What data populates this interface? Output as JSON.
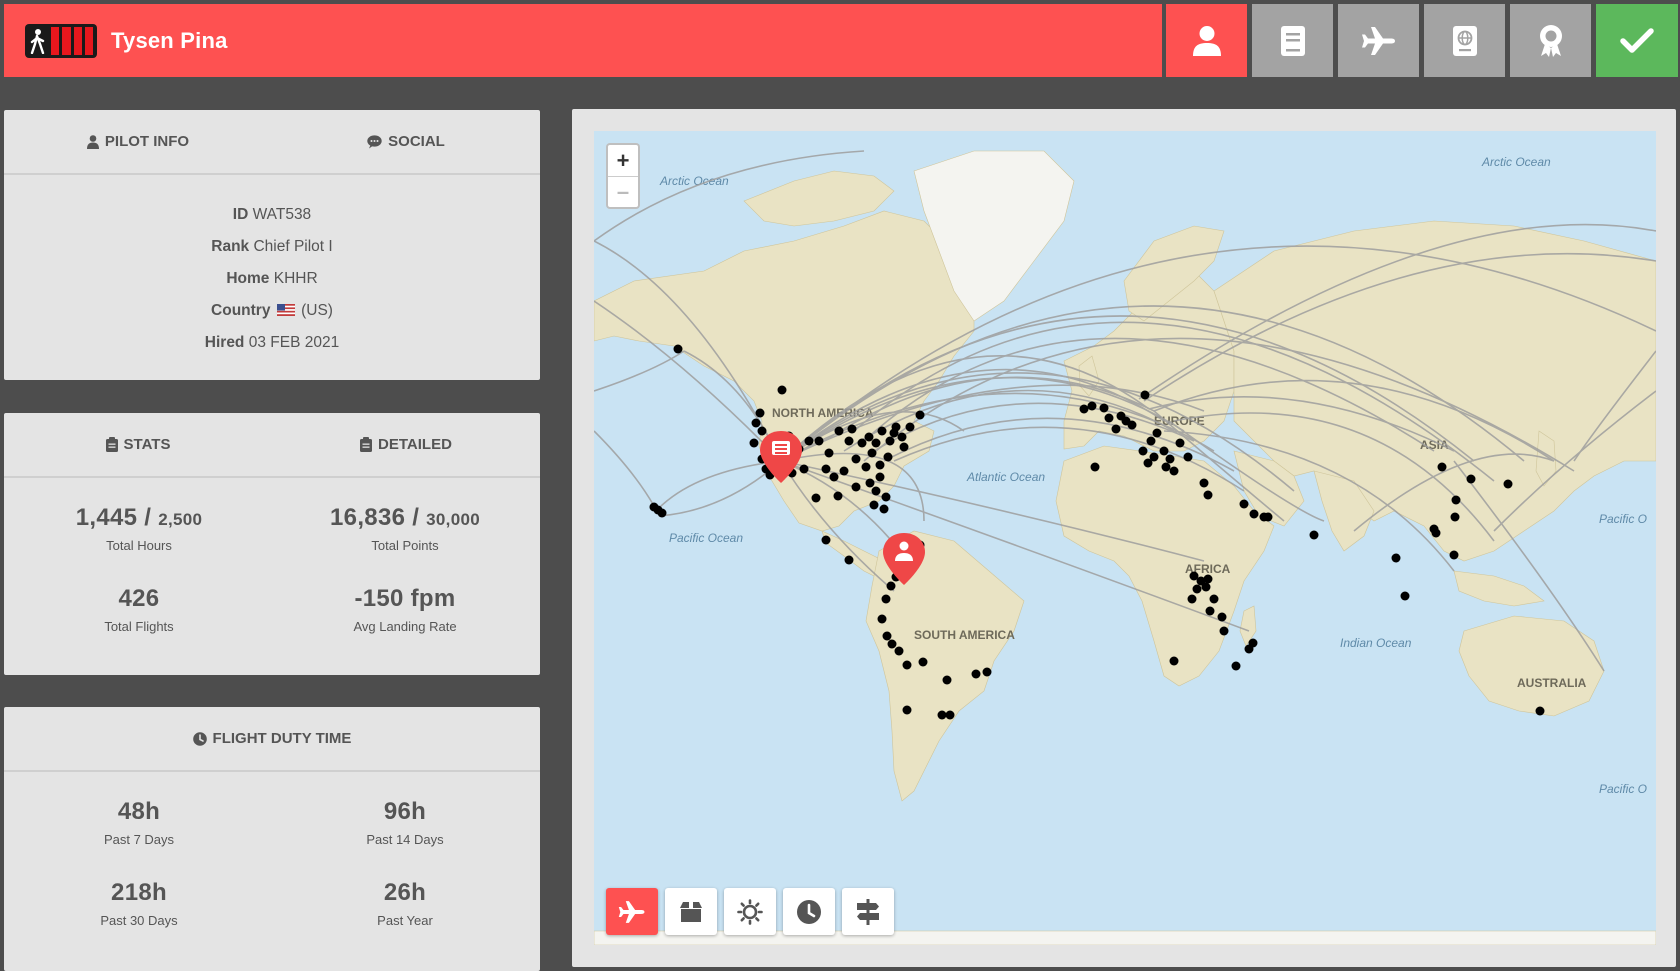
{
  "header": {
    "pilot_name": "Tysen Pina"
  },
  "nav": [
    {
      "name": "profile",
      "icon": "user-icon",
      "active": true
    },
    {
      "name": "logbook",
      "icon": "book-icon",
      "active": false
    },
    {
      "name": "flights",
      "icon": "plane-icon",
      "active": false
    },
    {
      "name": "passport",
      "icon": "passport-icon",
      "active": false
    },
    {
      "name": "awards",
      "icon": "award-icon",
      "active": false
    },
    {
      "name": "confirm",
      "icon": "check-icon",
      "active": false
    }
  ],
  "pilot_panel": {
    "tab_info": "PILOT INFO",
    "tab_social": "SOCIAL",
    "id_label": "ID",
    "id_value": "WAT538",
    "rank_label": "Rank",
    "rank_value": "Chief Pilot I",
    "home_label": "Home",
    "home_value": "KHHR",
    "country_label": "Country",
    "country_value": "(US)",
    "hired_label": "Hired",
    "hired_value": "03 FEB 2021"
  },
  "stats_panel": {
    "tab_stats": "STATS",
    "tab_detailed": "DETAILED",
    "hours_value": "1,445 /",
    "hours_goal": "2,500",
    "hours_label": "Total Hours",
    "points_value": "16,836 /",
    "points_goal": "30,000",
    "points_label": "Total Points",
    "flights_value": "426",
    "flights_label": "Total Flights",
    "landing_value": "-150 fpm",
    "landing_label": "Avg Landing Rate"
  },
  "duty_panel": {
    "title": "FLIGHT DUTY TIME",
    "d7_value": "48h",
    "d7_label": "Past 7 Days",
    "d14_value": "96h",
    "d14_label": "Past 14 Days",
    "d30_value": "218h",
    "d30_label": "Past 30 Days",
    "year_value": "26h",
    "year_label": "Past Year"
  },
  "map": {
    "zoom_in": "+",
    "zoom_out": "–",
    "labels": {
      "arctic_ocean_1": "Arctic Ocean",
      "arctic_ocean_2": "Arctic Ocean",
      "north_america": "NORTH AMERICA",
      "europe": "EUROPE",
      "asia": "ASIA",
      "africa": "AFRICA",
      "south_america": "SOUTH AMERICA",
      "australia": "AUSTRALIA",
      "atlantic_ocean": "Atlantic Ocean",
      "pacific_ocean_1": "Pacific Ocean",
      "pacific_ocean_2": "Pacific O",
      "pacific_ocean_3": "Pacific O",
      "indian_ocean": "Indian Ocean"
    },
    "tools": [
      "plane-icon",
      "box-icon",
      "weather-icon",
      "clock-icon",
      "signpost-icon"
    ],
    "colors": {
      "accent": "#fe5151",
      "ok": "#5cb85c",
      "route": "#9e9e9e",
      "dot": "#000000"
    }
  }
}
